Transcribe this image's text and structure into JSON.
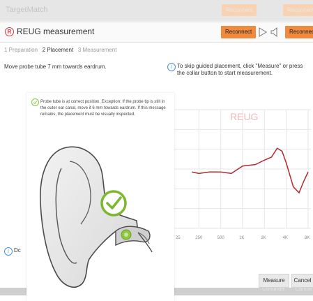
{
  "background_window": {
    "title": "TargetMatch",
    "reconnect_label_1": "Reconnect",
    "reconnect_label_2": "Reconnect",
    "continue_label": "Continue",
    "cancel_label": "Cancel"
  },
  "dialog": {
    "badge": "R",
    "title": "REUG measurement",
    "reconnect_label": "Reconnect",
    "reconnect_right_label": "Reconnect",
    "steps": {
      "step1": "1 Preparation",
      "step2": "2 Placement",
      "step3": "3 Measurement"
    },
    "instruction_left": "Move probe tube 7 mm towards eardrum.",
    "instruction_right": "To skip guided placement, click \"Measure\" or press the collar button to start measurement.",
    "status_text": "Probe tube is at correct position. Exception: If the probe tip is still in the outer ear canal, move it 6 mm towards eardrum. If this message remains, the placement must be visually inspected.",
    "bottom_info": "Dc",
    "measure_label": "Measure",
    "cancel_label": "Cancel"
  },
  "colors": {
    "accent_orange": "#f08a3e",
    "curve_red": "#b3282d",
    "check_green": "#7cb82f",
    "info_blue": "#4a90d9"
  },
  "chart_data": {
    "type": "line",
    "title": "REUG",
    "x_tick_labels": [
      "25",
      "250",
      "500",
      "1K",
      "2K",
      "4K",
      "8K"
    ],
    "series": [
      {
        "x": [
          200,
          250,
          350,
          500,
          700,
          1000,
          1500,
          2000,
          2500,
          3000,
          3500,
          4000,
          5000,
          6000,
          7000,
          8000
        ],
        "values": [
          -1,
          -1.5,
          -1,
          -1,
          -1.5,
          1,
          1.5,
          3,
          4,
          7,
          6,
          2,
          -6,
          -8,
          -4,
          -1
        ]
      }
    ],
    "ylim": [
      -20,
      20
    ],
    "grid": true
  }
}
